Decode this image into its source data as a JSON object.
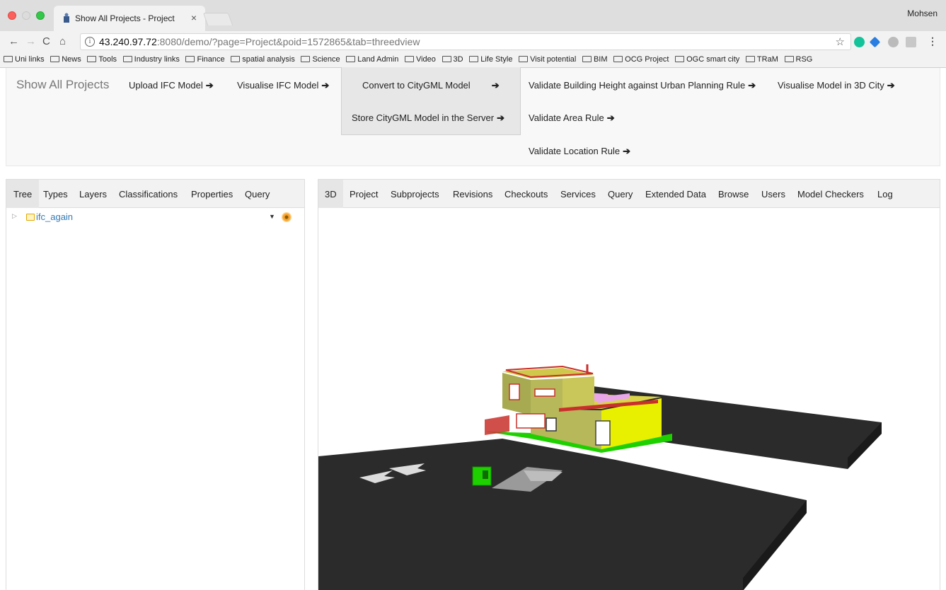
{
  "browser": {
    "tab_title": "Show All Projects - Project",
    "tab_close": "×",
    "profile": "Mohsen",
    "url_host": "43.240.97.72",
    "url_rest": ":8080/demo/?page=Project&poid=1572865&tab=threedview",
    "info_symbol": "i",
    "bookmarks": [
      "Uni links",
      "News",
      "Tools",
      "Industry links",
      "Finance",
      "spatial analysis",
      "Science",
      "Land Admin",
      "Video",
      "3D",
      "Life Style",
      "Visit potential",
      "BIM",
      "OCG Project",
      "OGC smart city",
      "TRaM",
      "RSG"
    ]
  },
  "nav": {
    "brand": "Show All Projects",
    "upload": "Upload IFC Model",
    "visualise_ifc": "Visualise IFC Model",
    "convert": "Convert to CityGML Model",
    "store": "Store CityGML Model in the Server",
    "validate_height": "Validate Building Height against Urban Planning Rule",
    "validate_area": "Validate Area Rule",
    "validate_location": "Validate Location Rule",
    "visualise_city": "Visualise Model in 3D City",
    "arrow": "➔"
  },
  "left_tabs": [
    "Tree",
    "Types",
    "Layers",
    "Classifications",
    "Properties",
    "Query"
  ],
  "tree": {
    "root_label": "ifc_again"
  },
  "right_tabs": [
    "3D",
    "Project",
    "Subprojects",
    "Revisions",
    "Checkouts",
    "Services",
    "Query",
    "Extended Data",
    "Browse",
    "Users",
    "Model Checkers",
    "Log"
  ],
  "colors": {
    "road": "#2b2b2b",
    "wall_yellow": "#e8f000",
    "wall_olive": "#b7b85a",
    "roof_pink": "#e9a7e9",
    "ground_green": "#1fd000",
    "frame_red": "#c9302c",
    "link_blue": "#337ab7"
  }
}
